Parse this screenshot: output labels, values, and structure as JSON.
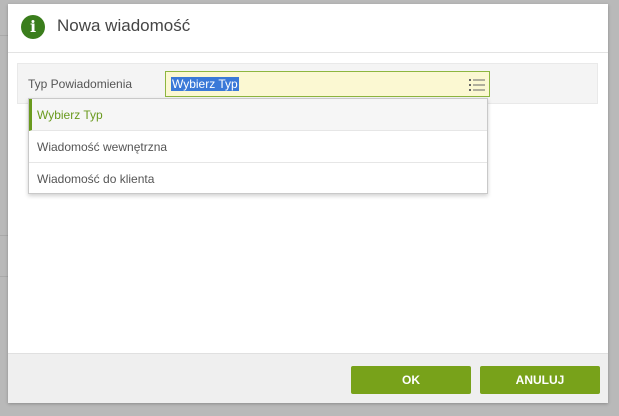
{
  "dialog": {
    "title": "Nowa wiadomość",
    "icon": "info-icon",
    "accent_color": "#78a21a"
  },
  "form": {
    "type_label": "Typ Powiadomienia",
    "type_value": "Wybierz Typ",
    "list_icon": "list-icon"
  },
  "dropdown": {
    "options": [
      {
        "label": "Wybierz Typ",
        "selected": true
      },
      {
        "label": "Wiadomość wewnętrzna",
        "selected": false
      },
      {
        "label": "Wiadomość do klienta",
        "selected": false
      }
    ]
  },
  "footer": {
    "ok_label": "OK",
    "cancel_label": "ANULUJ"
  }
}
